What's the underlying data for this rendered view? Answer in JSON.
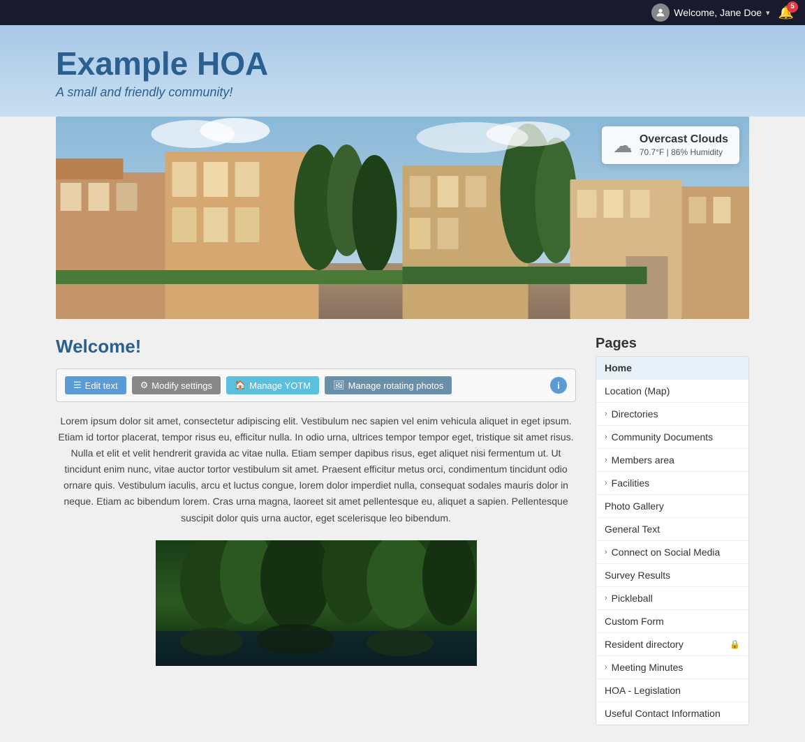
{
  "topbar": {
    "welcome_text": "Welcome, Jane Doe",
    "notification_count": "5"
  },
  "header": {
    "site_title": "Example HOA",
    "site_subtitle": "A small and friendly community!"
  },
  "weather": {
    "condition": "Overcast Clouds",
    "details": "70.7°F | 86% Humidity"
  },
  "main": {
    "welcome_heading": "Welcome!",
    "toolbar": {
      "edit_text": "Edit text",
      "modify_settings": "Modify settings",
      "manage_yotm": "Manage YOTM",
      "manage_photos": "Manage rotating photos",
      "info_label": "i"
    },
    "body_text": "Lorem ipsum dolor sit amet, consectetur adipiscing elit. Vestibulum nec sapien vel enim vehicula aliquet in eget ipsum. Etiam id tortor placerat, tempor risus eu, efficitur nulla. In odio urna, ultrices tempor tempor eget, tristique sit amet risus. Nulla et elit et velit hendrerit gravida ac vitae nulla. Etiam semper dapibus risus, eget aliquet nisi fermentum ut. Ut tincidunt enim nunc, vitae auctor tortor vestibulum sit amet. Praesent efficitur metus orci, condimentum tincidunt odio ornare quis. Vestibulum iaculis, arcu et luctus congue, lorem dolor imperdiet nulla, consequat sodales mauris dolor in neque. Etiam ac bibendum lorem. Cras urna magna, laoreet sit amet pellentesque eu, aliquet a sapien. Pellentesque suscipit dolor quis urna auctor, eget scelerisque leo bibendum."
  },
  "sidebar": {
    "heading": "Pages",
    "items": [
      {
        "label": "Home",
        "has_chevron": false,
        "has_lock": false,
        "active": true
      },
      {
        "label": "Location (Map)",
        "has_chevron": false,
        "has_lock": false,
        "active": false
      },
      {
        "label": "Directories",
        "has_chevron": true,
        "has_lock": false,
        "active": false
      },
      {
        "label": "Community Documents",
        "has_chevron": true,
        "has_lock": false,
        "active": false
      },
      {
        "label": "Members area",
        "has_chevron": true,
        "has_lock": false,
        "active": false
      },
      {
        "label": "Facilities",
        "has_chevron": true,
        "has_lock": false,
        "active": false
      },
      {
        "label": "Photo Gallery",
        "has_chevron": false,
        "has_lock": false,
        "active": false
      },
      {
        "label": "General Text",
        "has_chevron": false,
        "has_lock": false,
        "active": false
      },
      {
        "label": "Connect on Social Media",
        "has_chevron": true,
        "has_lock": false,
        "active": false
      },
      {
        "label": "Survey Results",
        "has_chevron": false,
        "has_lock": false,
        "active": false
      },
      {
        "label": "Pickleball",
        "has_chevron": true,
        "has_lock": false,
        "active": false
      },
      {
        "label": "Custom Form",
        "has_chevron": false,
        "has_lock": false,
        "active": false
      },
      {
        "label": "Resident directory",
        "has_chevron": false,
        "has_lock": true,
        "active": false
      },
      {
        "label": "Meeting Minutes",
        "has_chevron": true,
        "has_lock": false,
        "active": false
      },
      {
        "label": "HOA - Legislation",
        "has_chevron": false,
        "has_lock": false,
        "active": false
      },
      {
        "label": "Useful Contact Information",
        "has_chevron": false,
        "has_lock": false,
        "active": false
      }
    ]
  }
}
